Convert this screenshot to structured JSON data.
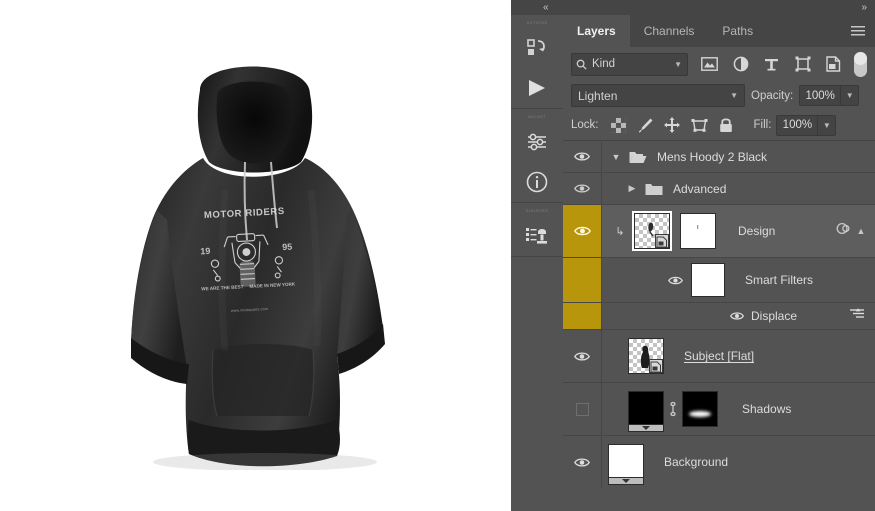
{
  "app": {
    "collapse_left_icon": "double-chevron-left-icon",
    "collapse_right_icon": "double-chevron-right-icon"
  },
  "canvas": {
    "artwork_name": "mens-hoody-black-mockup",
    "background_color": "#ffffff",
    "garment_color": "#2e2e2e",
    "print_design": {
      "arc_text": "MOTOR RIDERS",
      "year_left": "19",
      "year_right": "95",
      "footer_left": "WE ARE\nTHE\nBEST",
      "footer_right": "MADE IN\nNEW YORK",
      "url_text": "www.motorparts.com",
      "graphic": "motorcycle-illustration"
    }
  },
  "toolrail": {
    "sections": [
      {
        "label": "actions",
        "buttons": [
          {
            "name": "history-step-icon",
            "title": "History"
          },
          {
            "name": "play-action-icon",
            "title": "Play"
          }
        ]
      },
      {
        "label": "adjust",
        "buttons": [
          {
            "name": "sliders-icon",
            "title": "Properties"
          },
          {
            "name": "info-icon",
            "title": "Info"
          }
        ]
      },
      {
        "label": "sources",
        "buttons": [
          {
            "name": "clone-source-icon",
            "title": "Clone Source"
          }
        ]
      }
    ]
  },
  "panel": {
    "tabs": [
      {
        "label": "Layers",
        "active": true
      },
      {
        "label": "Channels",
        "active": false
      },
      {
        "label": "Paths",
        "active": false
      }
    ],
    "menu_icon": "hamburger-menu-icon",
    "filter": {
      "search_icon": "search-icon",
      "kind_label": "Kind",
      "caret_icon": "chevron-down-icon",
      "type_filters": [
        {
          "name": "filter-pixel-icon",
          "title": "Pixel layers"
        },
        {
          "name": "filter-adjustment-icon",
          "title": "Adjustment layers"
        },
        {
          "name": "filter-type-icon",
          "title": "Type layers"
        },
        {
          "name": "filter-shape-icon",
          "title": "Shape layers"
        },
        {
          "name": "filter-smart-object-icon",
          "title": "Smart objects"
        }
      ],
      "toggle_name": "filter-enable-toggle"
    },
    "blend": {
      "mode": "Lighten",
      "mode_caret": "chevron-down-icon",
      "opacity_label": "Opacity:",
      "opacity_value": "100%",
      "opacity_caret": "chevron-down-icon"
    },
    "lock": {
      "label": "Lock:",
      "fill_label": "Fill:",
      "fill_value": "100%",
      "fill_caret": "chevron-down-icon",
      "buttons": [
        {
          "name": "lock-transparent-pixels-icon",
          "title": "Lock transparent pixels"
        },
        {
          "name": "lock-image-pixels-icon",
          "title": "Lock image pixels"
        },
        {
          "name": "lock-position-icon",
          "title": "Lock position"
        },
        {
          "name": "lock-artboard-nesting-icon",
          "title": "Prevent auto-nesting"
        },
        {
          "name": "lock-all-icon",
          "title": "Lock all"
        }
      ]
    },
    "layers": [
      {
        "id": "group-mens-hoody",
        "name": "Mens Hoody 2 Black",
        "type": "group",
        "visible": true,
        "selected": false,
        "expanded": true,
        "indent": 0,
        "expand_icon": "chevron-down-icon",
        "folder_icon": "folder-open-icon"
      },
      {
        "id": "group-advanced",
        "name": "Advanced",
        "type": "group",
        "visible": true,
        "selected": false,
        "expanded": false,
        "indent": 1,
        "expand_icon": "chevron-right-icon",
        "folder_icon": "folder-closed-icon"
      },
      {
        "id": "layer-design",
        "name": "Design",
        "type": "smart-object",
        "visible": true,
        "selected": true,
        "indent": 1,
        "clipped": true,
        "clip_icon": "clipping-mask-arrow-icon",
        "has_mask": true,
        "thumbnail": "transparent-design-thumbnail",
        "mask_thumbnail": "white-layer-mask",
        "right_icons": [
          {
            "name": "smart-filter-icon",
            "title": "Smart Filters"
          },
          {
            "name": "chevron-up-icon",
            "title": "Collapse smart filters"
          }
        ]
      },
      {
        "id": "smart-filters-header",
        "name": "Smart Filters",
        "type": "smart-filter-header",
        "visible": true,
        "selected": false,
        "indent": 2,
        "mask_thumbnail": "white-filter-mask"
      },
      {
        "id": "filter-displace",
        "name": "Displace",
        "type": "smart-filter",
        "visible": true,
        "selected": false,
        "indent": 3,
        "right_icons": [
          {
            "name": "filter-blending-options-icon",
            "title": "Filter blending options"
          }
        ]
      },
      {
        "id": "layer-subject-flat",
        "name": "Subject [Flat]",
        "type": "pixel",
        "visible": true,
        "selected": false,
        "indent": 1,
        "underlined": true,
        "thumbnail": "transparent-subject-thumbnail"
      },
      {
        "id": "layer-shadows",
        "name": "Shadows",
        "type": "pixel",
        "visible": false,
        "selected": false,
        "indent": 1,
        "has_mask": true,
        "linked": true,
        "link_icon": "link-icon",
        "thumbnail": "black-shadow-thumbnail",
        "mask_thumbnail": "black-mask-with-white-ellipse"
      },
      {
        "id": "layer-background",
        "name": "Background",
        "type": "background",
        "visible": true,
        "selected": false,
        "indent": 0,
        "thumbnail": "white-background-thumbnail"
      }
    ]
  },
  "colors": {
    "panel_bg": "#535353",
    "panel_dark": "#454545",
    "selected_row": "#5e5e5e",
    "accent_gold": "#b8960c",
    "text": "#dcdcdc",
    "text_dim": "#b6b6b6"
  }
}
